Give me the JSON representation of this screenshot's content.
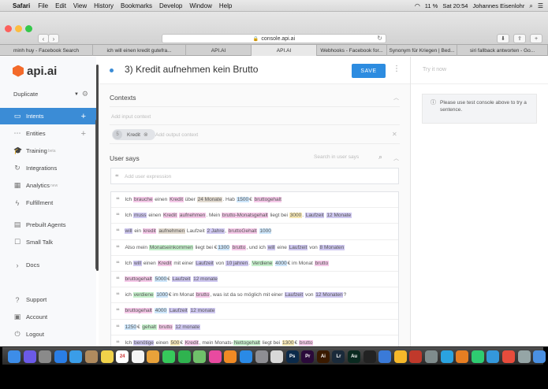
{
  "menubar": {
    "apple": "",
    "app": "Safari",
    "items": [
      "File",
      "Edit",
      "View",
      "History",
      "Bookmarks",
      "Develop",
      "Window",
      "Help"
    ],
    "battery": "11 %",
    "clock": "Sat 20:54",
    "user": "Johannes Eisenlohr"
  },
  "browser": {
    "url": "console.api.ai",
    "tabs": [
      {
        "label": "minh huy - Facebook Search",
        "active": false
      },
      {
        "label": "ich will einen kredit gutefra...",
        "active": false
      },
      {
        "label": "API.AI",
        "active": false
      },
      {
        "label": "API.AI",
        "active": true
      },
      {
        "label": "Webhooks - Facebook for...",
        "active": false
      },
      {
        "label": "Synonym für Kriegen | Bed...",
        "active": false
      },
      {
        "label": "siri fallback antworten - Go...",
        "active": false
      }
    ]
  },
  "sidebar": {
    "logo_text": "api.ai",
    "agent": "Duplicate",
    "items": [
      {
        "label": "Intents",
        "icon": "chat-icon",
        "plus": true,
        "active": true,
        "tag": ""
      },
      {
        "label": "Entities",
        "icon": "entities-icon",
        "plus": true,
        "active": false,
        "tag": ""
      },
      {
        "label": "Training",
        "icon": "training-icon",
        "plus": false,
        "active": false,
        "tag": "beta"
      },
      {
        "label": "Integrations",
        "icon": "integrations-icon",
        "plus": false,
        "active": false,
        "tag": ""
      },
      {
        "label": "Analytics",
        "icon": "analytics-icon",
        "plus": false,
        "active": false,
        "tag": "new"
      },
      {
        "label": "Fulfillment",
        "icon": "bolt-icon",
        "plus": false,
        "active": false,
        "tag": ""
      },
      {
        "label": "Prebuilt Agents",
        "icon": "prebuilt-icon",
        "plus": false,
        "active": false,
        "tag": ""
      },
      {
        "label": "Small Talk",
        "icon": "small-talk-icon",
        "plus": false,
        "active": false,
        "tag": ""
      },
      {
        "label": "Docs",
        "icon": "chevron-right-icon",
        "plus": false,
        "active": false,
        "tag": ""
      },
      {
        "label": "Support",
        "icon": "help-icon",
        "plus": false,
        "active": false,
        "tag": ""
      },
      {
        "label": "Account",
        "icon": "account-icon",
        "plus": false,
        "active": false,
        "tag": ""
      },
      {
        "label": "Logout",
        "icon": "power-icon",
        "plus": false,
        "active": false,
        "tag": ""
      }
    ]
  },
  "intent": {
    "title": "3) Kredit aufnehmen kein Brutto",
    "save_label": "SAVE",
    "contexts_title": "Contexts",
    "input_context_placeholder": "Add input context",
    "context_chip_num": "5",
    "context_chip_label": "Kredit",
    "output_context_placeholder": "Add output context",
    "user_says_title": "User says",
    "search_placeholder": "Search in user says",
    "expression_placeholder": "Add user expression"
  },
  "examples": [
    [
      [
        "Ich ",
        ""
      ],
      [
        "brauche",
        "c1"
      ],
      [
        " einen ",
        ""
      ],
      [
        "Kredit",
        "c1"
      ],
      [
        " über ",
        ""
      ],
      [
        "24 Monate",
        "c6"
      ],
      [
        ". Hab ",
        ""
      ],
      [
        "1500",
        "c3"
      ],
      [
        "€ ",
        ""
      ],
      [
        "bruttogehalt",
        "c1"
      ]
    ],
    [
      [
        "Ich ",
        ""
      ],
      [
        "muss",
        "c2"
      ],
      [
        " einen ",
        ""
      ],
      [
        "Kredit",
        "c1"
      ],
      [
        " ",
        ""
      ],
      [
        "aufnehmen",
        "c1"
      ],
      [
        ". Mein ",
        ""
      ],
      [
        "brutto-Monatsgehalt",
        "c1"
      ],
      [
        " liegt bei ",
        ""
      ],
      [
        "3000",
        "c5"
      ],
      [
        ". ",
        ""
      ],
      [
        "Laufzeit",
        "c2"
      ],
      [
        " ",
        ""
      ],
      [
        "12 Monate",
        "c2"
      ]
    ],
    [
      [
        "will",
        "c2"
      ],
      [
        " ein ",
        ""
      ],
      [
        "kredit",
        "c1"
      ],
      [
        " ",
        ""
      ],
      [
        "aufnehmen",
        "c6"
      ],
      [
        " Laufzeit ",
        ""
      ],
      [
        "2 Jahre",
        "c2"
      ],
      [
        ", ",
        ""
      ],
      [
        "bruttoGehalt",
        "c1"
      ],
      [
        " ",
        ""
      ],
      [
        "1000",
        "c3"
      ]
    ],
    [
      [
        "Also mein ",
        ""
      ],
      [
        "Monatseinkommen",
        "c4"
      ],
      [
        " liegt bei €",
        ""
      ],
      [
        "1300",
        "c3"
      ],
      [
        " ",
        ""
      ],
      [
        "brutto",
        "c1"
      ],
      [
        ", und ich ",
        ""
      ],
      [
        "will",
        "c2"
      ],
      [
        " eine ",
        ""
      ],
      [
        "Laufzeit",
        "c2"
      ],
      [
        " von ",
        ""
      ],
      [
        "8 Monaten",
        "c2"
      ]
    ],
    [
      [
        "Ich ",
        ""
      ],
      [
        "will",
        "c2"
      ],
      [
        " einen ",
        ""
      ],
      [
        "Kredit",
        "c1"
      ],
      [
        " mit einer ",
        ""
      ],
      [
        "Laufzeit",
        "c2"
      ],
      [
        " von ",
        ""
      ],
      [
        "10 jahren",
        "c2"
      ],
      [
        ". ",
        ""
      ],
      [
        "Verdiene",
        "c4"
      ],
      [
        " ",
        ""
      ],
      [
        "4000",
        "c3"
      ],
      [
        "€ im Monat ",
        ""
      ],
      [
        "brutto",
        "c1"
      ]
    ],
    [
      [
        "bruttogehalt",
        "c1"
      ],
      [
        " ",
        ""
      ],
      [
        "5000",
        "c3"
      ],
      [
        "€ ",
        ""
      ],
      [
        "Laufzeit",
        "c2"
      ],
      [
        " ",
        ""
      ],
      [
        "12 monate",
        "c2"
      ]
    ],
    [
      [
        "ich ",
        ""
      ],
      [
        "verdiene",
        "c4"
      ],
      [
        " ",
        ""
      ],
      [
        "1000",
        "c3"
      ],
      [
        "€ im Monat ",
        ""
      ],
      [
        "brutto",
        "c1"
      ],
      [
        ", was ist da so möglich mit einer ",
        ""
      ],
      [
        "Laufzeit",
        "c2"
      ],
      [
        " von ",
        ""
      ],
      [
        "12 Monaten",
        "c2"
      ],
      [
        "?",
        ""
      ]
    ],
    [
      [
        "bruttogehalt",
        "c1"
      ],
      [
        " ",
        ""
      ],
      [
        "4000",
        "c3"
      ],
      [
        " ",
        ""
      ],
      [
        "Laufzeit",
        "c2"
      ],
      [
        " ",
        ""
      ],
      [
        "12 monate",
        "c2"
      ]
    ],
    [
      [
        "1250",
        "c3"
      ],
      [
        "€ ",
        ""
      ],
      [
        "gehalt",
        "c4"
      ],
      [
        " ",
        ""
      ],
      [
        "brutto",
        "c1"
      ],
      [
        " ",
        ""
      ],
      [
        "12 monate",
        "c2"
      ]
    ],
    [
      [
        "Ich ",
        ""
      ],
      [
        "benötige",
        "c2"
      ],
      [
        " einen ",
        ""
      ],
      [
        "500",
        "c5"
      ],
      [
        "€ ",
        ""
      ],
      [
        "Kredit",
        "c1"
      ],
      [
        ", mein Monats-",
        ""
      ],
      [
        "Nettogehalt",
        "c4"
      ],
      [
        " liegt bei ",
        ""
      ],
      [
        "1300",
        "c5"
      ],
      [
        "€ ",
        ""
      ],
      [
        "brutto",
        "c1"
      ]
    ]
  ],
  "console": {
    "try_label": "Try it now",
    "info_text": "Please use test console above to try a sentence."
  },
  "dock": {
    "icons": [
      {
        "name": "finder-icon",
        "color": "#3d8de8",
        "label": ""
      },
      {
        "name": "siri-icon",
        "color": "#6b5ae8",
        "label": ""
      },
      {
        "name": "launchpad-icon",
        "color": "#8a8a8a",
        "label": ""
      },
      {
        "name": "safari-icon",
        "color": "#2a7ee6",
        "label": ""
      },
      {
        "name": "mail-icon",
        "color": "#3a9de8",
        "label": ""
      },
      {
        "name": "contacts-icon",
        "color": "#b08b5e",
        "label": ""
      },
      {
        "name": "notes-icon",
        "color": "#f1d24a",
        "label": ""
      },
      {
        "name": "calendar-icon",
        "color": "#ffffff",
        "label": "24"
      },
      {
        "name": "reminders-icon",
        "color": "#f5f5f5",
        "label": ""
      },
      {
        "name": "photos-icon",
        "color": "#e8a23a",
        "label": ""
      },
      {
        "name": "messages-icon",
        "color": "#36c95b",
        "label": ""
      },
      {
        "name": "facetime-icon",
        "color": "#2fb34f",
        "label": ""
      },
      {
        "name": "maps-icon",
        "color": "#6fc06a",
        "label": ""
      },
      {
        "name": "itunes-icon",
        "color": "#e84aa0",
        "label": ""
      },
      {
        "name": "ibooks-icon",
        "color": "#f08a24",
        "label": ""
      },
      {
        "name": "appstore-icon",
        "color": "#2a8ae6",
        "label": ""
      },
      {
        "name": "preferences-icon",
        "color": "#8e8e93",
        "label": ""
      },
      {
        "name": "chrome-icon",
        "color": "#d8d8d8",
        "label": ""
      },
      {
        "name": "photoshop-icon",
        "color": "#0b2a4a",
        "label": "Ps"
      },
      {
        "name": "premiere-icon",
        "color": "#2a0a3a",
        "label": "Pr"
      },
      {
        "name": "illustrator-icon",
        "color": "#3a1a00",
        "label": "Ai"
      },
      {
        "name": "lightroom-icon",
        "color": "#1a2a3a",
        "label": "Lr"
      },
      {
        "name": "audition-icon",
        "color": "#0a2a20",
        "label": "Au"
      },
      {
        "name": "terminal-icon",
        "color": "#222222",
        "label": ""
      },
      {
        "name": "xcode-icon",
        "color": "#3a7ad8",
        "label": ""
      },
      {
        "name": "sketch-icon",
        "color": "#f5b82a",
        "label": ""
      },
      {
        "name": "app-icon-a",
        "color": "#c0392b",
        "label": ""
      },
      {
        "name": "app-icon-b",
        "color": "#7f8c8d",
        "label": ""
      },
      {
        "name": "telegram-icon",
        "color": "#2aa3e0",
        "label": ""
      },
      {
        "name": "app-icon-c",
        "color": "#e67e22",
        "label": ""
      },
      {
        "name": "app-icon-d",
        "color": "#2ecc71",
        "label": ""
      },
      {
        "name": "app-icon-e",
        "color": "#3498db",
        "label": ""
      },
      {
        "name": "app-icon-f",
        "color": "#e74c3c",
        "label": ""
      },
      {
        "name": "app-icon-g",
        "color": "#95a5a6",
        "label": ""
      },
      {
        "name": "downloads-icon",
        "color": "#4a90e2",
        "label": ""
      },
      {
        "name": "folder-icon",
        "color": "#7aa7e0",
        "label": ""
      },
      {
        "name": "trash-icon",
        "color": "#bfbfbf",
        "label": ""
      }
    ]
  },
  "colors": {
    "accent": "#3b8cd6",
    "save_button": "#2d8ce0",
    "logo_orange": "#f36a2a"
  }
}
